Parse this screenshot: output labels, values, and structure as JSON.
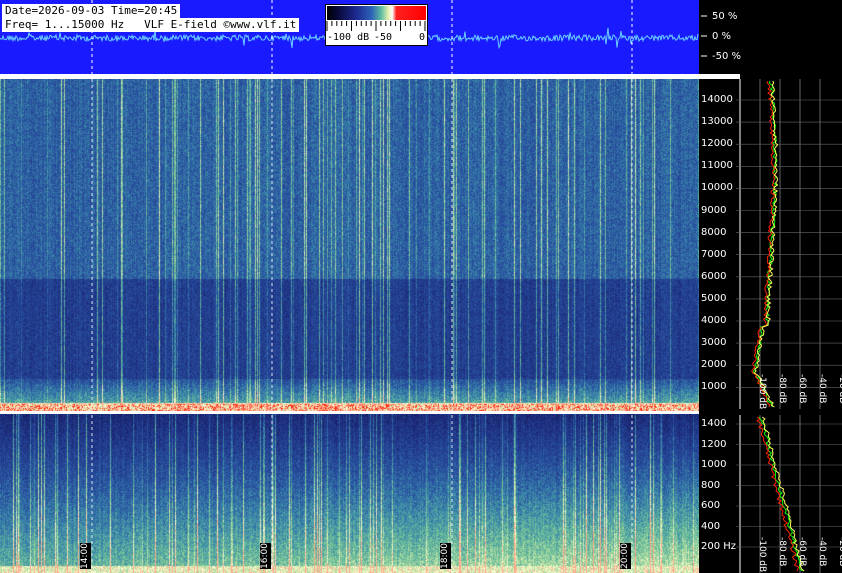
{
  "header": {
    "line1": "Date=2026-09-03 Time=20:45",
    "line2": "Freq= 1...15000 Hz   VLF E-field ©www.vlf.it"
  },
  "colorbar": {
    "labels": [
      "-100 dB",
      "-50",
      "0"
    ]
  },
  "amplitude_axis": [
    "50 %",
    "0 %",
    "-50 %"
  ],
  "upper_freq_axis": [
    "14000",
    "13000",
    "12000",
    "11000",
    "10000",
    "9000",
    "8000",
    "7000",
    "6000",
    "5000",
    "4000",
    "3000",
    "2000",
    "1000"
  ],
  "lower_freq_axis": [
    "1400",
    "1200",
    "1000",
    "800",
    "600",
    "400",
    "200 Hz"
  ],
  "time_labels": [
    "14:00",
    "16:00",
    "18:00",
    "20:00"
  ],
  "db_axis_upper": [
    "-100 dB",
    "-80 dB",
    "-60 dB",
    "-40 dB",
    "-20 dB"
  ],
  "db_axis_lower": [
    "-100 dB",
    "-80 dB",
    "-60 dB",
    "-40 dB",
    "-20 dB"
  ],
  "colors": {
    "header_bg": "#1a1aff",
    "waveform": "#6ad0ff",
    "spectrum_green": "#00ff00",
    "spectrum_red": "#ff2000"
  }
}
